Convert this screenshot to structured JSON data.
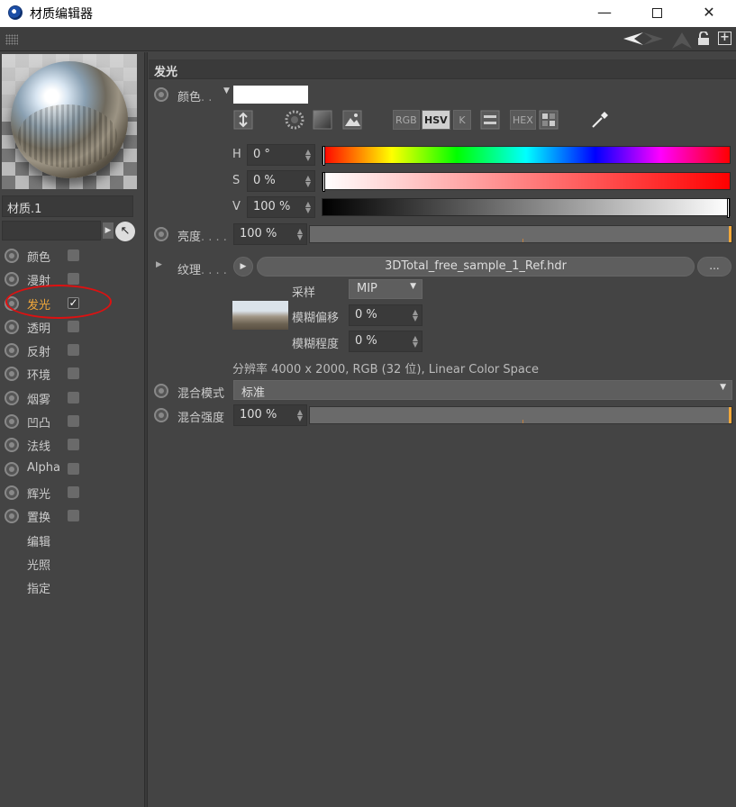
{
  "window": {
    "title": "材质编辑器",
    "min": "—",
    "close": "✕"
  },
  "toolbar": {
    "newwin": "+"
  },
  "material": {
    "name": "材质.1"
  },
  "channels": [
    {
      "label": "颜色",
      "checked": false
    },
    {
      "label": "漫射",
      "checked": false
    },
    {
      "label": "发光",
      "checked": true,
      "active": true
    },
    {
      "label": "透明",
      "checked": false
    },
    {
      "label": "反射",
      "checked": false
    },
    {
      "label": "环境",
      "checked": false
    },
    {
      "label": "烟雾",
      "checked": false
    },
    {
      "label": "凹凸",
      "checked": false
    },
    {
      "label": "法线",
      "checked": false
    },
    {
      "label": "Alpha",
      "checked": false
    },
    {
      "label": "辉光",
      "checked": false
    },
    {
      "label": "置换",
      "checked": false
    }
  ],
  "extra_items": [
    "编辑",
    "光照",
    "指定"
  ],
  "check_mark": "✓",
  "section": {
    "title": "发光"
  },
  "color": {
    "label": "颜色",
    "dots": ". .",
    "swatch_color": "#ffffff",
    "modes": [
      "RGB",
      "HSV",
      "K",
      "HEX"
    ],
    "selected_mode": "HSV",
    "h_label": "H",
    "h_value": "0 °",
    "s_label": "S",
    "s_value": "0 %",
    "v_label": "V",
    "v_value": "100 %"
  },
  "brightness": {
    "label": "亮度",
    "dots": ". . . .",
    "value": "100 %"
  },
  "texture": {
    "label": "纹理",
    "dots": ". . . .",
    "file": "3DTotal_free_sample_1_Ref.hdr",
    "more": "...",
    "sampling_label": "采样",
    "sampling_value": "MIP",
    "blur_offset_label": "模糊偏移",
    "blur_offset_value": "0 %",
    "blur_scale_label": "模糊程度",
    "blur_scale_value": "0 %",
    "info": "分辨率 4000 x 2000, RGB (32 位), Linear Color Space"
  },
  "mix_mode": {
    "label": "混合模式",
    "value": "标准"
  },
  "mix_strength": {
    "label": "混合强度",
    "value": "100 %"
  },
  "accent_color": "#f2a83a",
  "highlight_color": "#dd1111"
}
